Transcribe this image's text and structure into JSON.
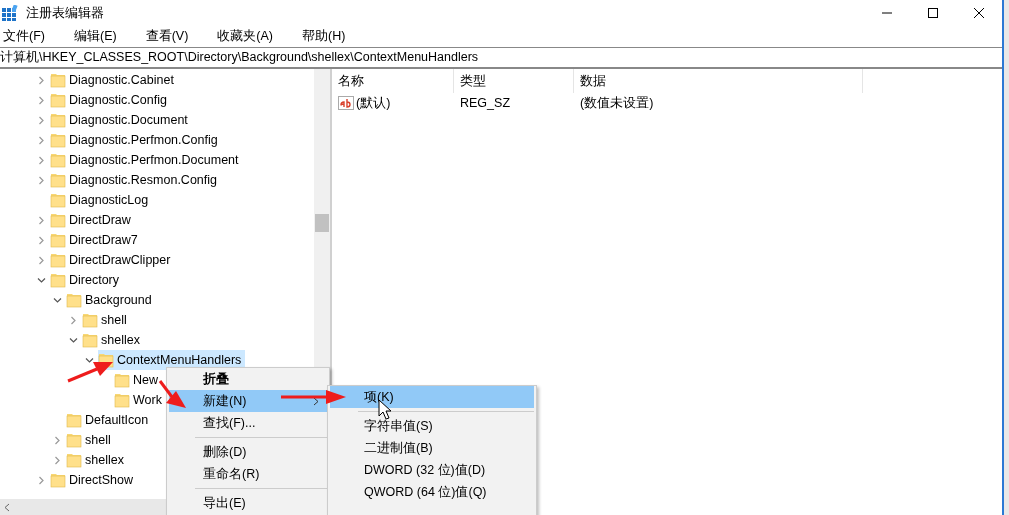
{
  "window": {
    "title": "注册表编辑器"
  },
  "menu_bar": [
    "文件(F)",
    "编辑(E)",
    "查看(V)",
    "收藏夹(A)",
    "帮助(H)"
  ],
  "address_bar": {
    "value": "计算机\\HKEY_CLASSES_ROOT\\Directory\\Background\\shellex\\ContextMenuHandlers"
  },
  "tree": [
    {
      "label": "Diagnostic.Cabinet",
      "expanded": false,
      "selected": false
    },
    {
      "label": "Diagnostic.Config",
      "expanded": false,
      "selected": false
    },
    {
      "label": "Diagnostic.Document",
      "expanded": false,
      "selected": false
    },
    {
      "label": "Diagnostic.Perfmon.Config",
      "expanded": false,
      "selected": false
    },
    {
      "label": "Diagnostic.Perfmon.Document",
      "expanded": false,
      "selected": false
    },
    {
      "label": "Diagnostic.Resmon.Config",
      "expanded": false,
      "selected": false
    },
    {
      "label": "DiagnosticLog",
      "selected": false
    },
    {
      "label": "DirectDraw",
      "expanded": false,
      "selected": false
    },
    {
      "label": "DirectDraw7",
      "expanded": false,
      "selected": false
    },
    {
      "label": "DirectDrawClipper",
      "expanded": false,
      "selected": false
    },
    {
      "label": "Directory",
      "expanded": true,
      "selected": false,
      "children": [
        {
          "label": "Background",
          "expanded": true,
          "selected": false,
          "children": [
            {
              "label": "shell",
              "expanded": false,
              "selected": false
            },
            {
              "label": "shellex",
              "expanded": true,
              "selected": false,
              "children": [
                {
                  "label": "ContextMenuHandlers",
                  "expanded": true,
                  "selected": true,
                  "children": [
                    {
                      "label": "New",
                      "selected": false
                    },
                    {
                      "label": "Work",
                      "selected": false
                    }
                  ]
                }
              ]
            }
          ]
        },
        {
          "label": "DefaultIcon",
          "selected": false
        },
        {
          "label": "shell",
          "expanded": false,
          "selected": false
        },
        {
          "label": "shellex",
          "expanded": false,
          "selected": false
        }
      ]
    },
    {
      "label": "DirectShow",
      "expanded": false,
      "selected": false
    }
  ],
  "values_table": {
    "columns": [
      "名称",
      "类型",
      "数据"
    ],
    "rows": [
      {
        "name": "(默认)",
        "type": "REG_SZ",
        "data": "(数值未设置)"
      }
    ]
  },
  "context_menu": {
    "items": [
      {
        "kind": "item",
        "label": "折叠",
        "default": true,
        "selected": false,
        "submenu": false
      },
      {
        "kind": "item",
        "label": "新建(N)",
        "default": false,
        "selected": true,
        "submenu": true
      },
      {
        "kind": "item",
        "label": "查找(F)...",
        "default": false,
        "selected": false,
        "submenu": false
      },
      {
        "kind": "separator"
      },
      {
        "kind": "item",
        "label": "删除(D)",
        "default": false,
        "selected": false,
        "submenu": false
      },
      {
        "kind": "item",
        "label": "重命名(R)",
        "default": false,
        "selected": false,
        "submenu": false
      },
      {
        "kind": "separator"
      },
      {
        "kind": "item",
        "label": "导出(E)",
        "default": false,
        "selected": false,
        "submenu": false
      }
    ]
  },
  "submenu": {
    "items": [
      {
        "kind": "item",
        "label": "项(K)",
        "selected": true
      },
      {
        "kind": "separator"
      },
      {
        "kind": "item",
        "label": "字符串值(S)",
        "selected": false
      },
      {
        "kind": "item",
        "label": "二进制值(B)",
        "selected": false
      },
      {
        "kind": "item",
        "label": "DWORD (32 位)值(D)",
        "selected": false
      },
      {
        "kind": "item",
        "label": "QWORD (64 位)值(Q)",
        "selected": false
      }
    ]
  }
}
